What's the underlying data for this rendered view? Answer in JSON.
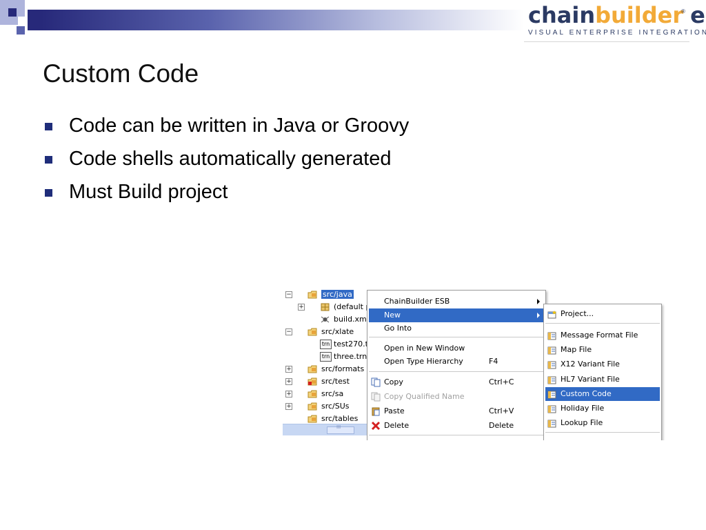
{
  "slide": {
    "title": "Custom Code",
    "bullets": [
      "Code can be written in Java or Groovy",
      "Code shells automatically generated",
      "Must Build project"
    ]
  },
  "logo": {
    "word_chain": "chain",
    "word_builder": "builder",
    "word_esb": "esb",
    "registered": "®",
    "tagline": "VISUAL ENTERPRISE INTEGRATION"
  },
  "tree": {
    "items": [
      {
        "label": "src/java",
        "icon": "source-folder-icon",
        "expander": "minus",
        "indent": 0,
        "selected": true
      },
      {
        "label": "(default p",
        "icon": "package-icon",
        "expander": "plus",
        "indent": 1
      },
      {
        "label": "build.xml",
        "icon": "ant-file-icon",
        "expander": "",
        "indent": 1
      },
      {
        "label": "src/xlate",
        "icon": "source-folder-icon",
        "expander": "minus",
        "indent": 0
      },
      {
        "label": "test270.t",
        "icon": "trn-file-icon",
        "icon_text": "trn",
        "expander": "",
        "indent": 1
      },
      {
        "label": "three.trn",
        "icon": "trn-file-icon",
        "icon_text": "trn",
        "expander": "",
        "indent": 1
      },
      {
        "label": "src/formats",
        "icon": "source-folder-icon",
        "expander": "plus",
        "indent": 0
      },
      {
        "label": "src/test",
        "icon": "source-folder-error-icon",
        "expander": "plus",
        "indent": 0
      },
      {
        "label": "src/sa",
        "icon": "source-folder-icon",
        "expander": "plus",
        "indent": 0
      },
      {
        "label": "src/SUs",
        "icon": "source-folder-icon",
        "expander": "plus",
        "indent": 0
      },
      {
        "label": "src/tables",
        "icon": "source-folder-icon",
        "expander": "",
        "indent": 0
      }
    ],
    "scroll_grip": "III"
  },
  "context_menu": {
    "items": [
      {
        "label": "ChainBuilder ESB",
        "shortcut": "",
        "submenu": true
      },
      {
        "label": "New",
        "shortcut": "",
        "submenu": true,
        "highlighted": true
      },
      {
        "label": "Go Into",
        "shortcut": ""
      },
      {
        "label": "Open in New Window",
        "shortcut": ""
      },
      {
        "label": "Open Type Hierarchy",
        "shortcut": "F4"
      },
      {
        "label": "Copy",
        "shortcut": "Ctrl+C",
        "icon": "copy-icon"
      },
      {
        "label": "Copy Qualified Name",
        "shortcut": "",
        "icon": "copy-qualified-name-icon",
        "disabled": true
      },
      {
        "label": "Paste",
        "shortcut": "Ctrl+V",
        "icon": "paste-icon"
      },
      {
        "label": "Delete",
        "shortcut": "Delete",
        "icon": "delete-icon"
      }
    ]
  },
  "new_submenu": {
    "items": [
      {
        "label": "Project...",
        "icon": "new-project-icon"
      },
      {
        "label": "Message Format File",
        "icon": "message-format-file-icon"
      },
      {
        "label": "Map File",
        "icon": "map-file-icon"
      },
      {
        "label": "X12 Variant File",
        "icon": "x12-variant-file-icon"
      },
      {
        "label": "HL7 Variant File",
        "icon": "hl7-variant-file-icon"
      },
      {
        "label": "Custom Code",
        "icon": "custom-code-icon",
        "highlighted": true
      },
      {
        "label": "Holiday File",
        "icon": "holiday-file-icon"
      },
      {
        "label": "Lookup File",
        "icon": "lookup-file-icon"
      }
    ]
  },
  "colors": {
    "bullet": "#1f2d7a",
    "logo_dark": "#2b3a63",
    "logo_orange": "#f2aa38",
    "menu_highlight": "#316ac5"
  }
}
